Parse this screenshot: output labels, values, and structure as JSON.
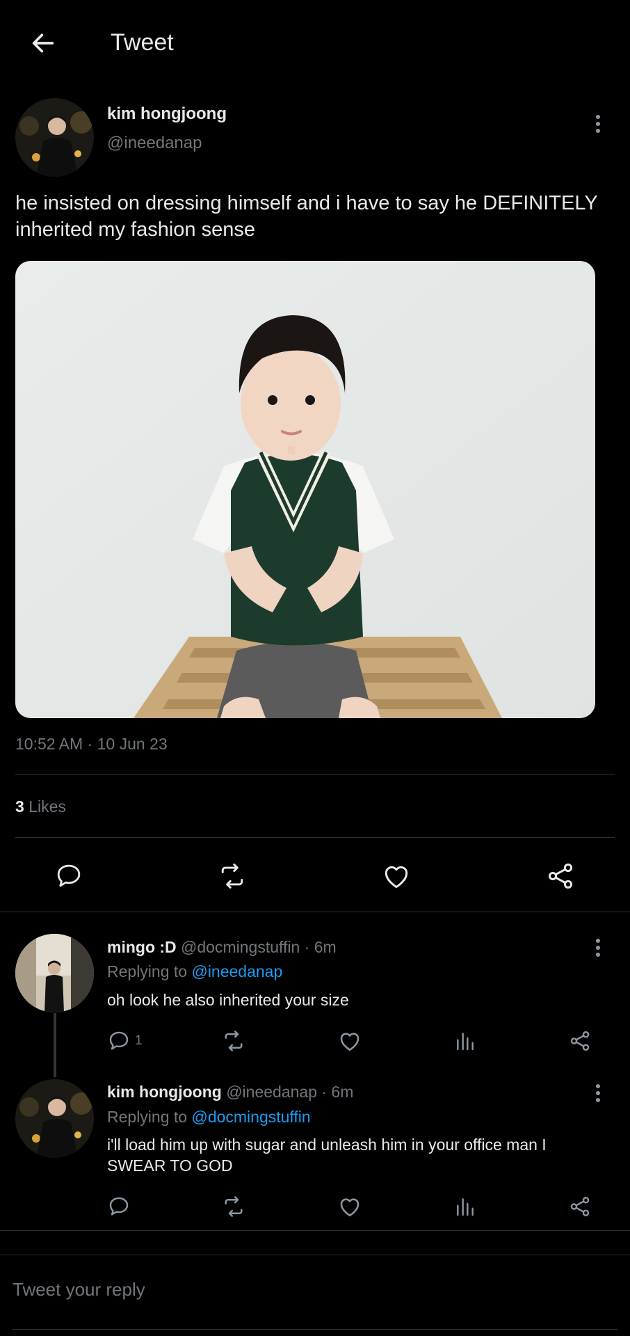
{
  "header": {
    "title": "Tweet",
    "back_icon": "arrow-left-icon"
  },
  "tweet": {
    "author_name": "kim hongjoong",
    "author_handle": "@ineedanap",
    "text": "he insisted on dressing himself and i have to say he DEFINITELY inherited my fashion sense",
    "timestamp": "10:52 AM · 10 Jun 23",
    "likes_count": "3",
    "likes_label": "Likes",
    "actions": [
      "reply-icon",
      "retweet-icon",
      "like-icon",
      "share-icon"
    ]
  },
  "replies": [
    {
      "name": "mingo :D",
      "meta": "@docmingstuffin · 6m",
      "replying_prefix": "Replying to ",
      "replying_to": "@ineedanap",
      "text": "oh look he also inherited your size",
      "reply_count": "1"
    },
    {
      "name": "kim hongjoong",
      "meta": "@ineedanap · 6m",
      "replying_prefix": "Replying to ",
      "replying_to": "@docmingstuffin",
      "text": "i'll load him up with sugar and unleash him in your office man I SWEAR TO GOD",
      "reply_count": ""
    }
  ],
  "compose": {
    "placeholder": "Tweet your reply"
  },
  "colors": {
    "background": "#000000",
    "text": "#e7e9ea",
    "muted": "#71767b",
    "link": "#1d9bf0",
    "divider": "#2f3336"
  }
}
